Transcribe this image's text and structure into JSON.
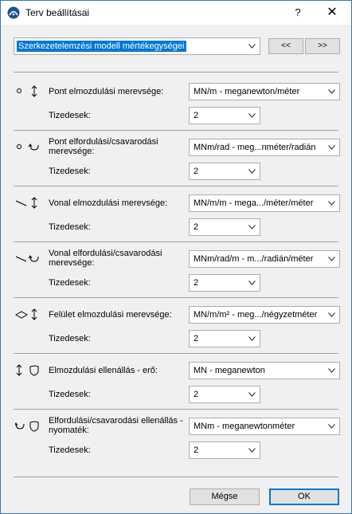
{
  "window": {
    "title": "Terv beállításai",
    "help_label": "?",
    "close_label": "✕"
  },
  "model_selector": {
    "value": "Szerkezetelemzési modell mértékegységei",
    "prev_label": "<<",
    "next_label": ">>"
  },
  "sections": [
    {
      "label": "Pont elmozdulási merevsége:",
      "unit": "MN/m - meganewton/méter",
      "decimals_label": "Tizedesek:",
      "decimals": "2",
      "icon": "point-displacement-icon"
    },
    {
      "label": "Pont elfordulási/csavarodási merevsége:",
      "unit": "MNm/rad - meg...nméter/radián",
      "decimals_label": "Tizedesek:",
      "decimals": "2",
      "icon": "point-rotation-icon"
    },
    {
      "label": "Vonal elmozdulási merevsége:",
      "unit": "MN/m/m - mega.../méter/méter",
      "decimals_label": "Tizedesek:",
      "decimals": "2",
      "icon": "line-displacement-icon"
    },
    {
      "label": "Vonal elfordulási/csavarodási merevsége:",
      "unit": "MNm/rad/m - m.../radián/méter",
      "decimals_label": "Tizedesek:",
      "decimals": "2",
      "icon": "line-rotation-icon"
    },
    {
      "label": "Felület elmozdulási merevsége:",
      "unit": "MN/m/m² - meg.../négyzetméter",
      "decimals_label": "Tizedesek:",
      "decimals": "2",
      "icon": "surface-displacement-icon"
    },
    {
      "label": "Elmozdulási ellenállás - erő:",
      "unit": "MN - meganewton",
      "decimals_label": "Tizedesek:",
      "decimals": "2",
      "icon": "displacement-resistance-icon"
    },
    {
      "label": "Elfordulási/csavarodási ellenállás - nyomaték:",
      "unit": "MNm - meganewtonméter",
      "decimals_label": "Tizedesek:",
      "decimals": "2",
      "icon": "rotation-resistance-icon"
    }
  ],
  "footer": {
    "cancel_label": "Mégse",
    "ok_label": "OK"
  }
}
